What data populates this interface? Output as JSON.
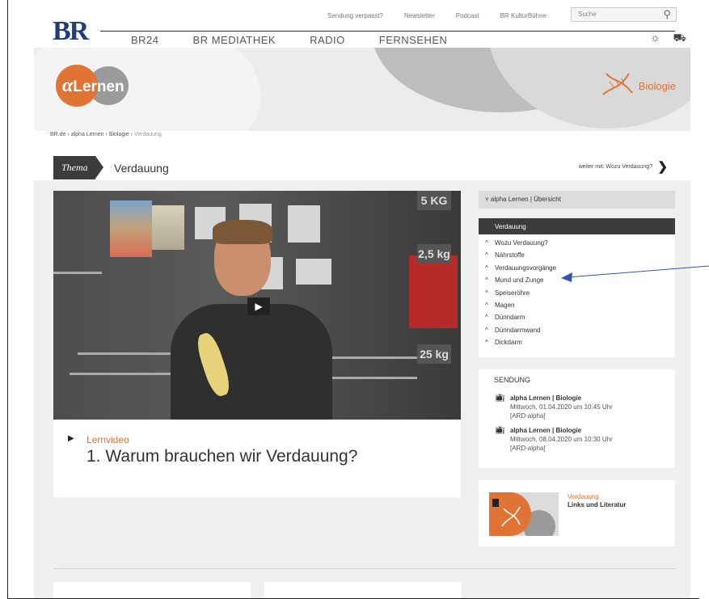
{
  "header": {
    "logo": "BR",
    "util_links": [
      "Sendung verpasst?",
      "Newsletter",
      "Podcast",
      "BR KulturBühne"
    ],
    "search_placeholder": "Suche",
    "main_nav": [
      "BR24",
      "BR MEDIATHEK",
      "RADIO",
      "FERNSEHEN"
    ]
  },
  "hero": {
    "logo_alpha": "α",
    "logo_text": "Lernen",
    "subject": "Biologie"
  },
  "breadcrumb": [
    "BR.de",
    "alpha Lernen",
    "Biologie",
    "Verdauung"
  ],
  "thema": {
    "tag": "Thema",
    "title": "Verdauung",
    "next_label": "weiter mit: Wozu Verdauung?"
  },
  "video": {
    "play_icon": "▶",
    "plates": [
      "5 KG",
      "2,5 kg",
      "25 kg"
    ],
    "caption_kind": "Lernvideo",
    "caption_title": "1. Warum brauchen wir Verdauung?"
  },
  "sidebar": {
    "overview": "alpha Lernen | Übersicht",
    "nav_header": "Verdauung",
    "nav_items": [
      "Wozu Verdauung?",
      "Nährstoffe",
      "Verdauungsvorgänge",
      "Mund und Zunge",
      "Speiseröhre",
      "Magen",
      "Dünndarm",
      "Dünndarmwand",
      "Dickdarm"
    ],
    "sendung_header": "SENDUNG",
    "broadcasts": [
      {
        "title": "alpha Lernen | Biologie",
        "date": "Mittwoch, 01.04.2020 um 10:45 Uhr",
        "channel": "[ARD-alpha]"
      },
      {
        "title": "alpha Lernen | Biologie",
        "date": "Mittwoch, 08.04.2020 um 10:30 Uhr",
        "channel": "[ARD-alpha]"
      }
    ],
    "link_kicker": "Verdauung",
    "link_title": "Links und Literatur"
  },
  "colors": {
    "accent": "#e07434",
    "brand_blue": "#1d3e7a",
    "dark": "#3c3c3c"
  }
}
